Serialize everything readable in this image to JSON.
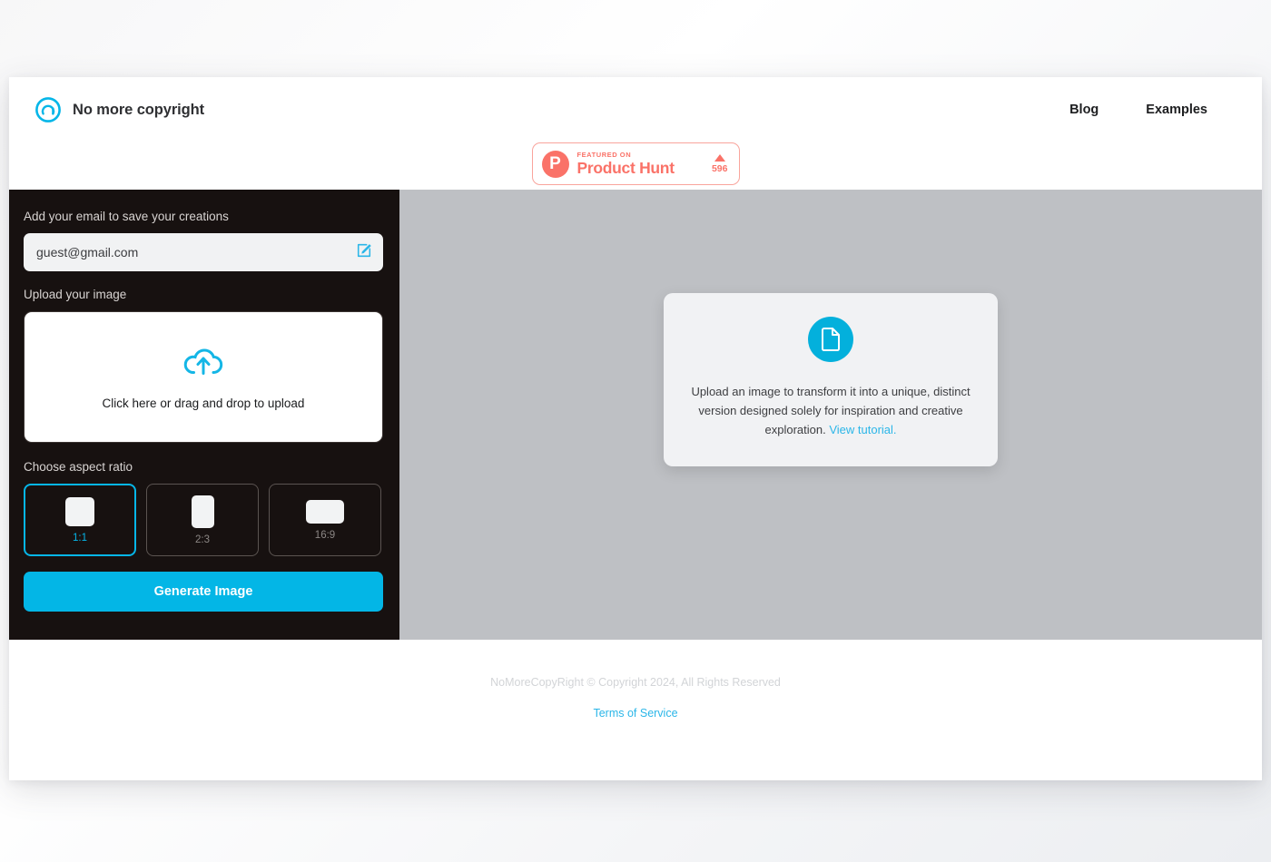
{
  "header": {
    "brand_name": "No more copyright",
    "logo_icon": "ring-logo-icon",
    "nav": [
      {
        "label": "Blog"
      },
      {
        "label": "Examples"
      }
    ],
    "product_hunt": {
      "mark": "P",
      "featured_label": "FEATURED ON",
      "title": "Product Hunt",
      "upvote_icon": "triangle-up-icon",
      "upvote_count": "596",
      "accent_color": "#fa7268"
    }
  },
  "sidebar": {
    "email_section_label": "Add your email to save your creations",
    "email_value": "guest@gmail.com",
    "email_placeholder": "guest@gmail.com",
    "edit_icon": "edit-pencil-icon",
    "upload_section_label": "Upload your image",
    "dropzone": {
      "icon": "cloud-upload-icon",
      "text": "Click here or drag and drop to upload"
    },
    "aspect_section_label": "Choose aspect ratio",
    "aspect_ratios": [
      {
        "label": "1:1",
        "selected": true
      },
      {
        "label": "2:3",
        "selected": false
      },
      {
        "label": "16:9",
        "selected": false
      }
    ],
    "generate_button_label": "Generate Image",
    "background_color": "#171110",
    "accent_color": "#03b6e6"
  },
  "canvas": {
    "background_color": "#bec0c4",
    "info_card": {
      "icon": "document-file-icon",
      "text": "Upload an image to transform it into a unique, distinct version designed solely for inspiration and creative exploration.",
      "link_label": "View tutorial."
    }
  },
  "footer": {
    "copyright": "NoMoreCopyRight © Copyright 2024, All Rights Reserved",
    "terms_label": "Terms of Service",
    "link_color": "#2bb6e8"
  }
}
